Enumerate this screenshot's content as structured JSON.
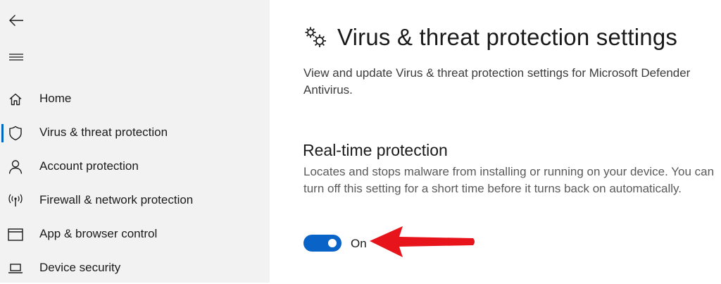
{
  "sidebar": {
    "back_icon": "back-arrow-icon",
    "menu_icon": "hamburger-menu-icon",
    "items": [
      {
        "label": "Home",
        "icon": "home-icon",
        "selected": false
      },
      {
        "label": "Virus & threat protection",
        "icon": "shield-icon",
        "selected": true
      },
      {
        "label": "Account protection",
        "icon": "person-icon",
        "selected": false
      },
      {
        "label": "Firewall & network protection",
        "icon": "wireless-antenna-icon",
        "selected": false
      },
      {
        "label": "App & browser control",
        "icon": "browser-window-icon",
        "selected": false
      },
      {
        "label": "Device security",
        "icon": "laptop-icon",
        "selected": false
      }
    ]
  },
  "main": {
    "title_icon": "gears-icon",
    "title": "Virus & threat protection settings",
    "description": "View and update Virus & threat protection settings for Microsoft Defender Antivirus.",
    "section": {
      "title": "Real-time protection",
      "description": "Locates and stops malware from installing or running on your device. You can turn off this setting for a short time before it turns back on automatically.",
      "toggle": {
        "state": "on",
        "label": "On"
      }
    },
    "annotation": {
      "icon": "red-pointer-arrow-icon"
    }
  },
  "colors": {
    "sidebar_bg": "#f2f2f2",
    "accent": "#0067c0",
    "toggle_on": "#0a64c8",
    "annotation_arrow": "#e8141b"
  }
}
